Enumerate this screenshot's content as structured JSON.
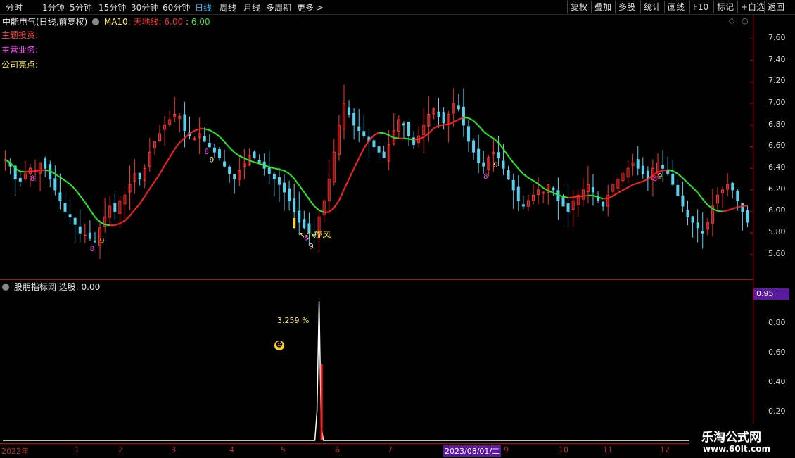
{
  "toolbar": {
    "periods": [
      "分时",
      "1分钟",
      "5分钟",
      "15分钟",
      "30分钟",
      "60分钟",
      "日线",
      "周线",
      "月线",
      "多周期",
      "更多"
    ],
    "more_chevron": ">",
    "active_period": "日线",
    "actions": [
      "复权",
      "叠加",
      "多股",
      "统计",
      "画线",
      "F10",
      "标记",
      "+自选",
      "返回"
    ]
  },
  "main_chart": {
    "stock_name": "中能电气(日线,前复权)",
    "ma_label": "MA10:",
    "tiandi_label": "天地线:",
    "tiandi_value1": "6.00",
    "tiandi_value2": "6.00",
    "info_labels": [
      "主题投资:",
      "主营业务:",
      "公司亮点:"
    ],
    "annotation": "小旋风",
    "price_ticks": [
      "7.60",
      "7.40",
      "7.20",
      "7.00",
      "6.80",
      "6.60",
      "6.40",
      "6.20",
      "6.00",
      "5.80",
      "5.60"
    ]
  },
  "indicator": {
    "name": "股朋指标网",
    "select_label": "选股:",
    "select_value": "0.00",
    "current_value": "0.95",
    "ticks": [
      "0.80",
      "0.60",
      "0.40",
      "0.20"
    ],
    "percent_label": "3.259 %"
  },
  "date_axis": {
    "start": "2022年",
    "months": [
      "1",
      "2",
      "3",
      "4",
      "5",
      "6",
      "7",
      "8",
      "9",
      "10",
      "11",
      "12"
    ],
    "cursor_date": "2023/08/01/二"
  },
  "watermark": {
    "title": "乐淘公式网",
    "url": "www.60lt.com"
  },
  "colors": {
    "up": "#ff3333",
    "down": "#54d2f0",
    "ma_up": "#ff2020",
    "ma_down": "#22ee22",
    "axis": "#cc0000",
    "nine_magenta": "#ff44ff",
    "nine_yellow": "#ffee66"
  },
  "chart_data": {
    "type": "candlestick",
    "title": "中能电气(日线,前复权)",
    "ylim": [
      5.5,
      7.75
    ],
    "closes": [
      6.48,
      6.42,
      6.3,
      6.28,
      6.35,
      6.4,
      6.38,
      6.45,
      6.4,
      6.3,
      6.2,
      6.1,
      6.0,
      5.95,
      5.88,
      5.8,
      5.78,
      5.75,
      5.72,
      5.85,
      5.95,
      6.05,
      6.0,
      6.1,
      6.15,
      6.25,
      6.35,
      6.3,
      6.4,
      6.55,
      6.65,
      6.72,
      6.8,
      6.85,
      6.9,
      6.88,
      6.75,
      6.7,
      6.68,
      6.72,
      6.65,
      6.6,
      6.55,
      6.5,
      6.42,
      6.35,
      6.3,
      6.38,
      6.45,
      6.52,
      6.5,
      6.45,
      6.4,
      6.35,
      6.3,
      6.25,
      6.18,
      6.1,
      6.0,
      5.9,
      5.85,
      5.8,
      5.78,
      5.95,
      6.1,
      6.3,
      6.55,
      6.8,
      7.0,
      6.9,
      6.8,
      6.75,
      6.7,
      6.65,
      6.6,
      6.55,
      6.5,
      6.62,
      6.75,
      6.85,
      6.8,
      6.7,
      6.62,
      6.7,
      6.8,
      6.9,
      6.95,
      6.88,
      6.82,
      6.9,
      7.0,
      6.95,
      6.8,
      6.65,
      6.55,
      6.45,
      6.42,
      6.5,
      6.55,
      6.5,
      6.4,
      6.3,
      6.2,
      6.1,
      6.05,
      6.1,
      6.15,
      6.2,
      6.18,
      6.25,
      6.2,
      6.1,
      6.05,
      6.0,
      6.1,
      6.15,
      6.2,
      6.25,
      6.18,
      6.1,
      6.05,
      6.15,
      6.25,
      6.3,
      6.35,
      6.4,
      6.45,
      6.4,
      6.35,
      6.3,
      6.4,
      6.45,
      6.4,
      6.35,
      6.25,
      6.15,
      6.05,
      5.95,
      5.9,
      5.85,
      5.8,
      5.9,
      6.05,
      6.15,
      6.2,
      6.25,
      6.2,
      6.1,
      6.0,
      5.9
    ],
    "indicator_series": {
      "name": "股朋指标网",
      "ylim": [
        0,
        1.0
      ],
      "spike_index": 63,
      "spike_value": 0.95,
      "spike_bar_value": 0.52
    }
  }
}
